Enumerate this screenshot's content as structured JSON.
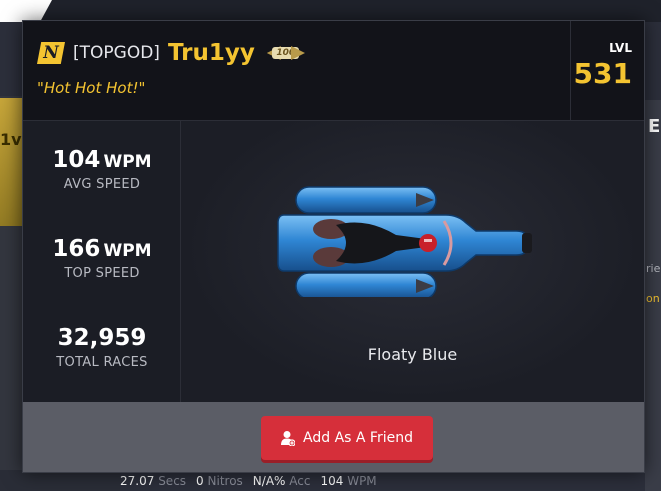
{
  "background": {
    "left_fragment_text": "1v",
    "right_heading_fragment": "E",
    "right_text_fragment_1": "rie",
    "right_text_fragment_2": "on",
    "bottom_stats": {
      "secs_value": "27.07",
      "secs_label": "Secs",
      "nitros_value": "0",
      "nitros_label": "Nitros",
      "acc_value": "N/A%",
      "acc_label": "Acc",
      "wpm_value": "104",
      "wpm_label": "WPM"
    }
  },
  "profile": {
    "team_tag": "[TOPGOD]",
    "username": "Tru1yy",
    "badge_number": "100",
    "quote": "\"Hot Hot Hot!\"",
    "level_label": "LVL",
    "level_value": "531"
  },
  "stats": [
    {
      "value": "104",
      "unit": "WPM",
      "label": "AVG SPEED"
    },
    {
      "value": "166",
      "unit": "WPM",
      "label": "TOP SPEED"
    },
    {
      "value": "32,959",
      "unit": "",
      "label": "TOTAL RACES"
    }
  ],
  "car": {
    "name": "Floaty Blue"
  },
  "actions": {
    "add_friend_label": "Add As A Friend"
  },
  "colors": {
    "accent_gold": "#f4c431",
    "button_red": "#d62f3a",
    "modal_bg": "#1b1d25",
    "footer_gray": "#5b5d66",
    "car_blue": "#2f86d4"
  },
  "icons": {
    "nt_logo": "nitro-type-logo-icon",
    "gold_badge": "gold-membership-badge-icon",
    "add_friend": "add-user-icon"
  }
}
